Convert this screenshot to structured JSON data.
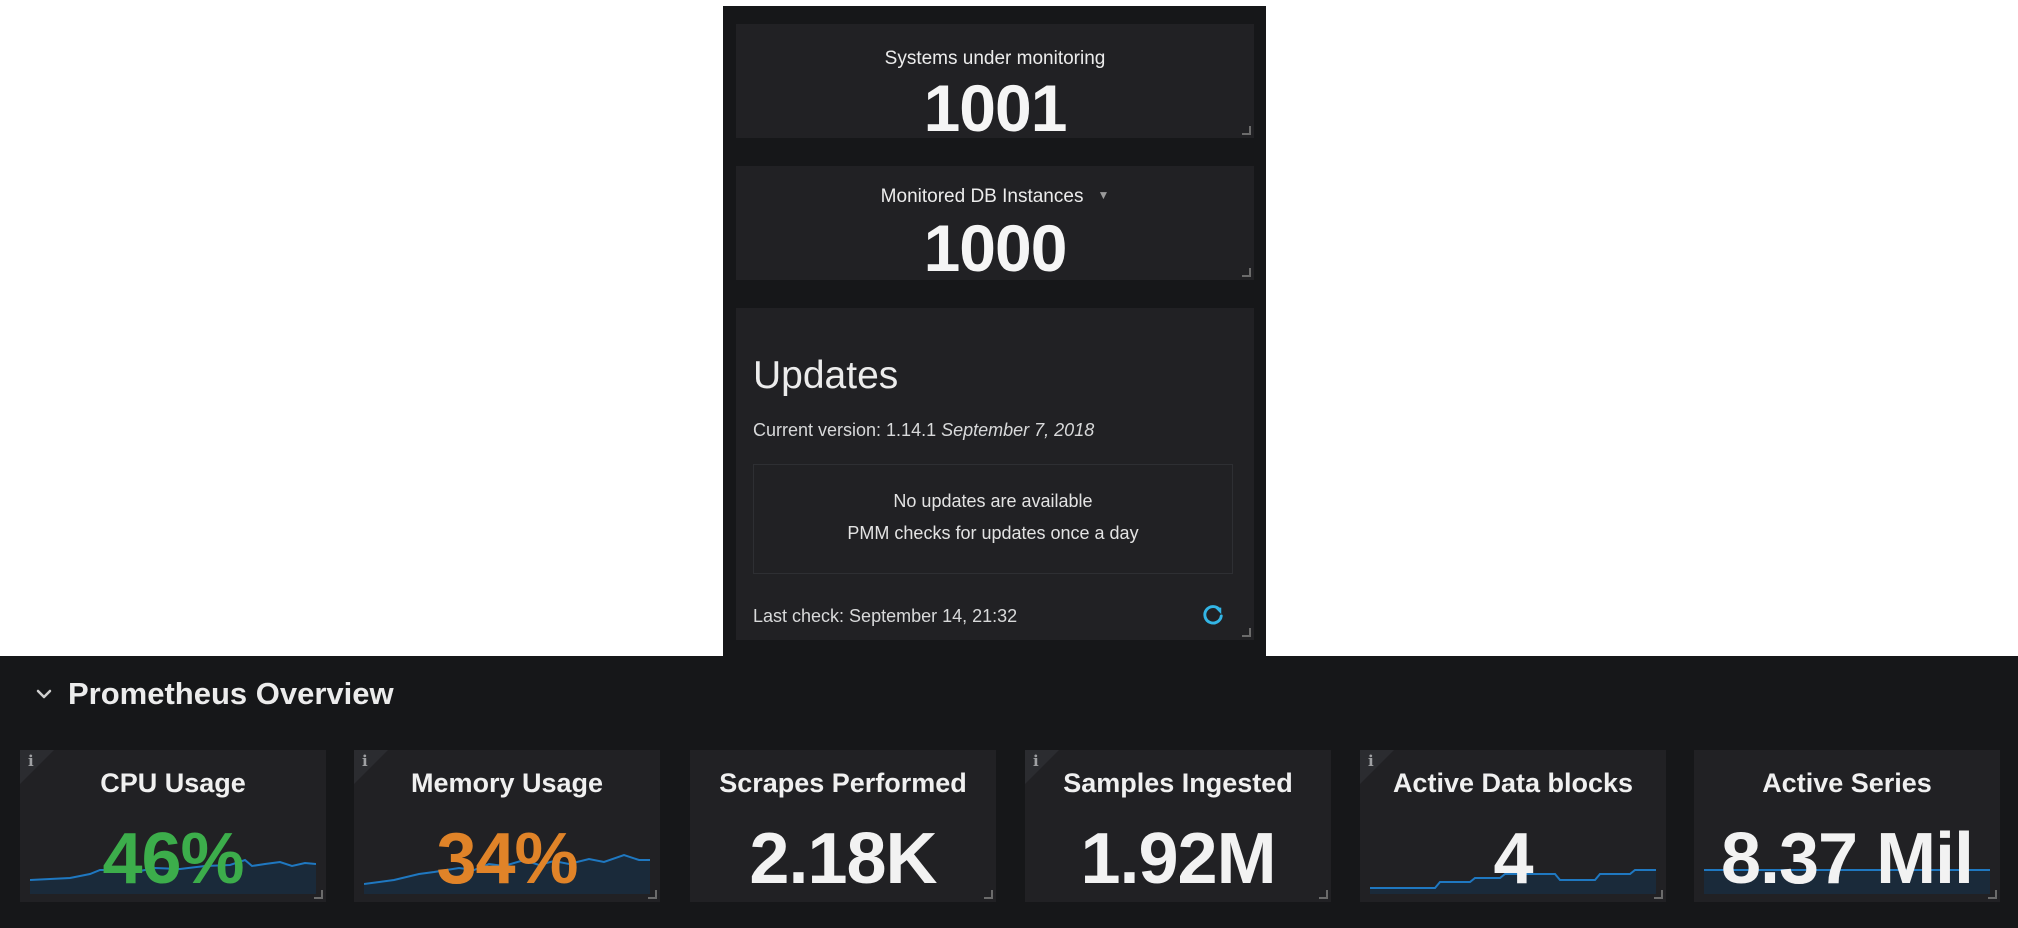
{
  "top_panels": {
    "systems": {
      "title": "Systems under monitoring",
      "value": "1001"
    },
    "db_instances": {
      "title": "Monitored DB Instances",
      "value": "1000"
    },
    "updates": {
      "title": "Updates",
      "version_prefix": "Current version: 1.14.1",
      "version_date": "September 7, 2018",
      "status_line1": "No updates are available",
      "status_line2": "PMM checks for updates once a day",
      "last_check": "Last check: September 14, 21:32",
      "refresh_icon": "refresh-icon"
    }
  },
  "prometheus": {
    "row_title": "Prometheus Overview",
    "chevron_icon": "chevron-down-icon",
    "tiles": [
      {
        "title": "CPU Usage",
        "value": "46%",
        "value_color": "#3cad4b",
        "has_info": true,
        "sparkline": true
      },
      {
        "title": "Memory Usage",
        "value": "34%",
        "value_color": "#e08328",
        "has_info": true,
        "sparkline": true
      },
      {
        "title": "Scrapes Performed",
        "value": "2.18K",
        "value_color": "#f2f2f2",
        "has_info": false,
        "sparkline": false
      },
      {
        "title": "Samples Ingested",
        "value": "1.92M",
        "value_color": "#f2f2f2",
        "has_info": true,
        "sparkline": false
      },
      {
        "title": "Active Data blocks",
        "value": "4",
        "value_color": "#f2f2f2",
        "has_info": true,
        "sparkline": true
      },
      {
        "title": "Active Series",
        "value": "8.37 Mil",
        "value_color": "#f2f2f2",
        "has_info": false,
        "sparkline": true
      }
    ]
  },
  "colors": {
    "sparkline_line": "#1f78c1",
    "sparkline_fill": "#1a2a3a",
    "refresh": "#33b5e5"
  }
}
